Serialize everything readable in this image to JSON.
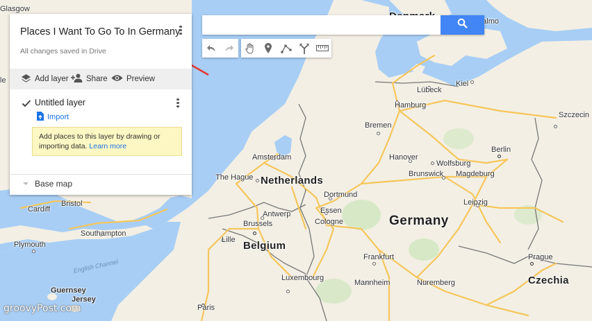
{
  "map_title": "Places I Want To Go To In Germany",
  "save_status": "All changes saved in Drive",
  "toolbar": {
    "add_layer": "Add layer",
    "share": "Share",
    "preview": "Preview"
  },
  "layer": {
    "name": "Untitled layer",
    "import_label": "Import",
    "tip_text": "Add places to this layer by drawing or importing data.",
    "tip_link": "Learn more"
  },
  "base_map_label": "Base map",
  "search": {
    "value": "",
    "placeholder": ""
  },
  "map_tools": [
    "undo-icon",
    "redo-icon",
    "hand-icon",
    "marker-icon",
    "draw-line-icon",
    "directions-icon",
    "ruler-icon"
  ],
  "colors": {
    "accent": "#4285f4",
    "arrow": "#e53935",
    "land": "#f3efe4",
    "water": "#a8cef5",
    "highway": "#f6c65b"
  },
  "map_labels": {
    "glasgow": "Glasgow",
    "denmark": "Denmark",
    "malmo": "Malmo",
    "lubeck": "Lübeck",
    "kiel": "Kiel",
    "hamburg": "Hamburg",
    "szczecin": "Szczecin",
    "bremen": "Bremen",
    "amsterdam": "Amsterdam",
    "hanover": "Hanover",
    "wolfsburg": "Wolfsburg",
    "berlin": "Berlin",
    "the_hague": "The Hague",
    "netherlands": "Netherlands",
    "brunswick": "Brunswick",
    "magdeburg": "Magdeburg",
    "dortmund": "Dortmund",
    "essen": "Essen",
    "leipzig": "Leipzig",
    "antwerp": "Antwerp",
    "cologne": "Cologne",
    "germany": "Germany",
    "brussels": "Brussels",
    "lille": "Lille",
    "belgium": "Belgium",
    "frankfurt": "Frankfurt",
    "southampton": "Southampton",
    "plymouth": "Plymouth",
    "english_channel": "English Channel",
    "luxembourg": "Luxembourg",
    "prague": "Prague",
    "czechia": "Czechia",
    "mannheim": "Mannheim",
    "nuremberg": "Nuremberg",
    "guernsey": "Guernsey",
    "jersey": "Jersey",
    "paris": "Paris",
    "bristol": "Bristol",
    "cardiff": "Cardiff",
    "le": "le"
  },
  "watermark": "groovyPost.com"
}
